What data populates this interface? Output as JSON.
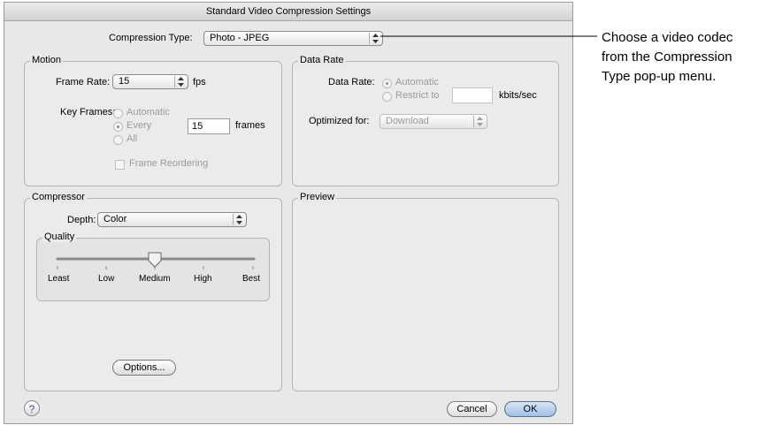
{
  "window": {
    "title": "Standard Video Compression Settings"
  },
  "compression_type": {
    "label": "Compression Type:",
    "value": "Photo - JPEG"
  },
  "motion": {
    "legend": "Motion",
    "frame_rate_label": "Frame Rate:",
    "frame_rate_value": "15",
    "frame_rate_unit": "fps",
    "key_frames_label": "Key Frames:",
    "key_frames_options": [
      "Automatic",
      "Every",
      "All"
    ],
    "key_frames_selected": "Every",
    "key_frames_value": "15",
    "key_frames_unit": "frames",
    "frame_reordering_label": "Frame Reordering"
  },
  "data_rate": {
    "legend": "Data Rate",
    "data_rate_label": "Data Rate:",
    "options": [
      "Automatic",
      "Restrict to"
    ],
    "selected": "Automatic",
    "restrict_value": "",
    "unit": "kbits/sec",
    "optimized_label": "Optimized for:",
    "optimized_value": "Download"
  },
  "compressor": {
    "legend": "Compressor",
    "depth_label": "Depth:",
    "depth_value": "Color",
    "quality_legend": "Quality",
    "quality_ticks": [
      "Least",
      "Low",
      "Medium",
      "High",
      "Best"
    ],
    "quality_selected": "Medium",
    "options_button": "Options..."
  },
  "preview": {
    "legend": "Preview"
  },
  "buttons": {
    "help": "?",
    "cancel": "Cancel",
    "ok": "OK"
  },
  "callout": {
    "lines": [
      "Choose a video codec",
      "from the Compression",
      "Type pop-up menu."
    ]
  }
}
